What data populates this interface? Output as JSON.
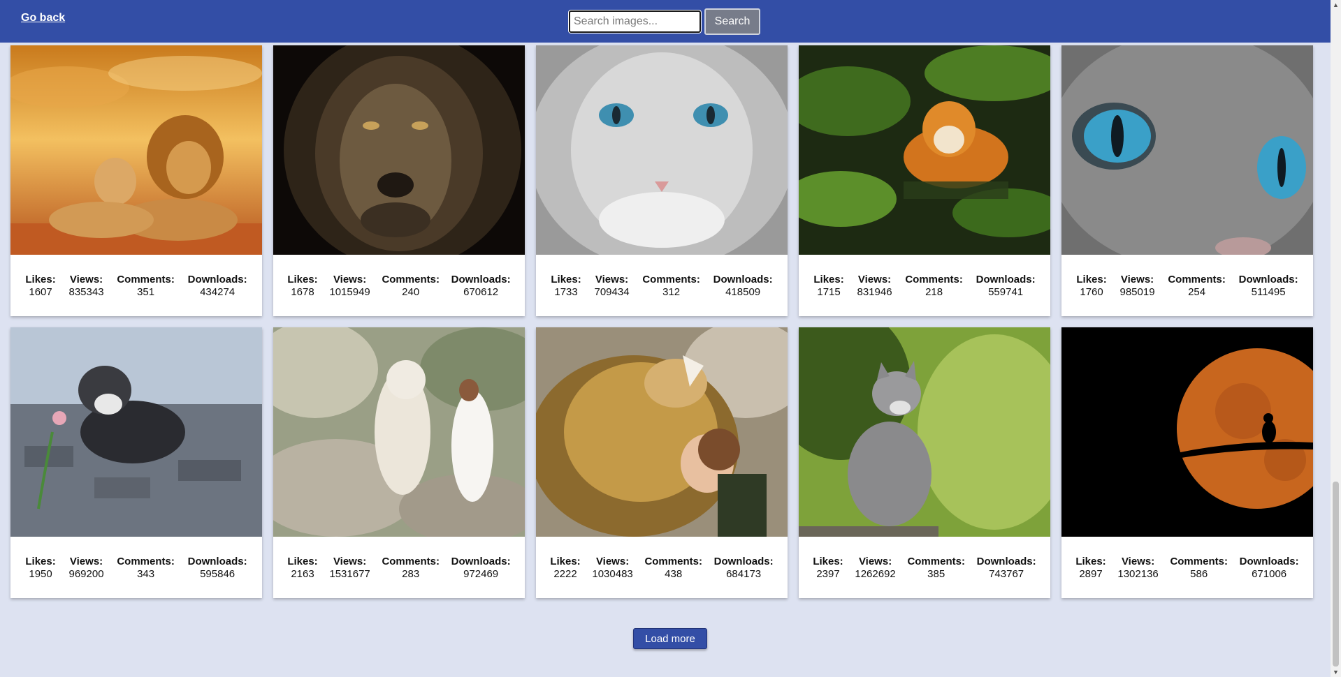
{
  "header": {
    "go_back_label": "Go back",
    "search_placeholder": "Search images...",
    "search_value": "",
    "search_button_label": "Search"
  },
  "stat_labels": {
    "likes": "Likes:",
    "views": "Views:",
    "comments": "Comments:",
    "downloads": "Downloads:"
  },
  "cards": [
    {
      "image": "lion-and-lioness-sunset",
      "likes": "1607",
      "views": "835343",
      "comments": "351",
      "downloads": "434274"
    },
    {
      "image": "lion-face-dark",
      "likes": "1678",
      "views": "1015949",
      "comments": "240",
      "downloads": "670612"
    },
    {
      "image": "grey-cat-blue-eyes",
      "likes": "1733",
      "views": "709434",
      "comments": "312",
      "downloads": "418509"
    },
    {
      "image": "tiger-in-water",
      "likes": "1715",
      "views": "831946",
      "comments": "218",
      "downloads": "559741"
    },
    {
      "image": "cat-blue-eyes-closeup",
      "likes": "1760",
      "views": "985019",
      "comments": "254",
      "downloads": "511495"
    },
    {
      "image": "kitten-with-flower",
      "likes": "1950",
      "views": "969200",
      "comments": "343",
      "downloads": "595846"
    },
    {
      "image": "white-tiger-and-woman",
      "likes": "2163",
      "views": "1531677",
      "comments": "283",
      "downloads": "972469"
    },
    {
      "image": "lion-and-girl",
      "likes": "2222",
      "views": "1030483",
      "comments": "438",
      "downloads": "684173"
    },
    {
      "image": "kitten-on-rock",
      "likes": "2397",
      "views": "1262692",
      "comments": "385",
      "downloads": "743767"
    },
    {
      "image": "cat-silhouette-moon",
      "likes": "2897",
      "views": "1302136",
      "comments": "586",
      "downloads": "671006"
    }
  ],
  "footer": {
    "load_more_label": "Load more"
  },
  "colors": {
    "header": "#334ea6",
    "background": "#dde2f1",
    "button": "#334ea6",
    "search_button": "#777c8a"
  }
}
